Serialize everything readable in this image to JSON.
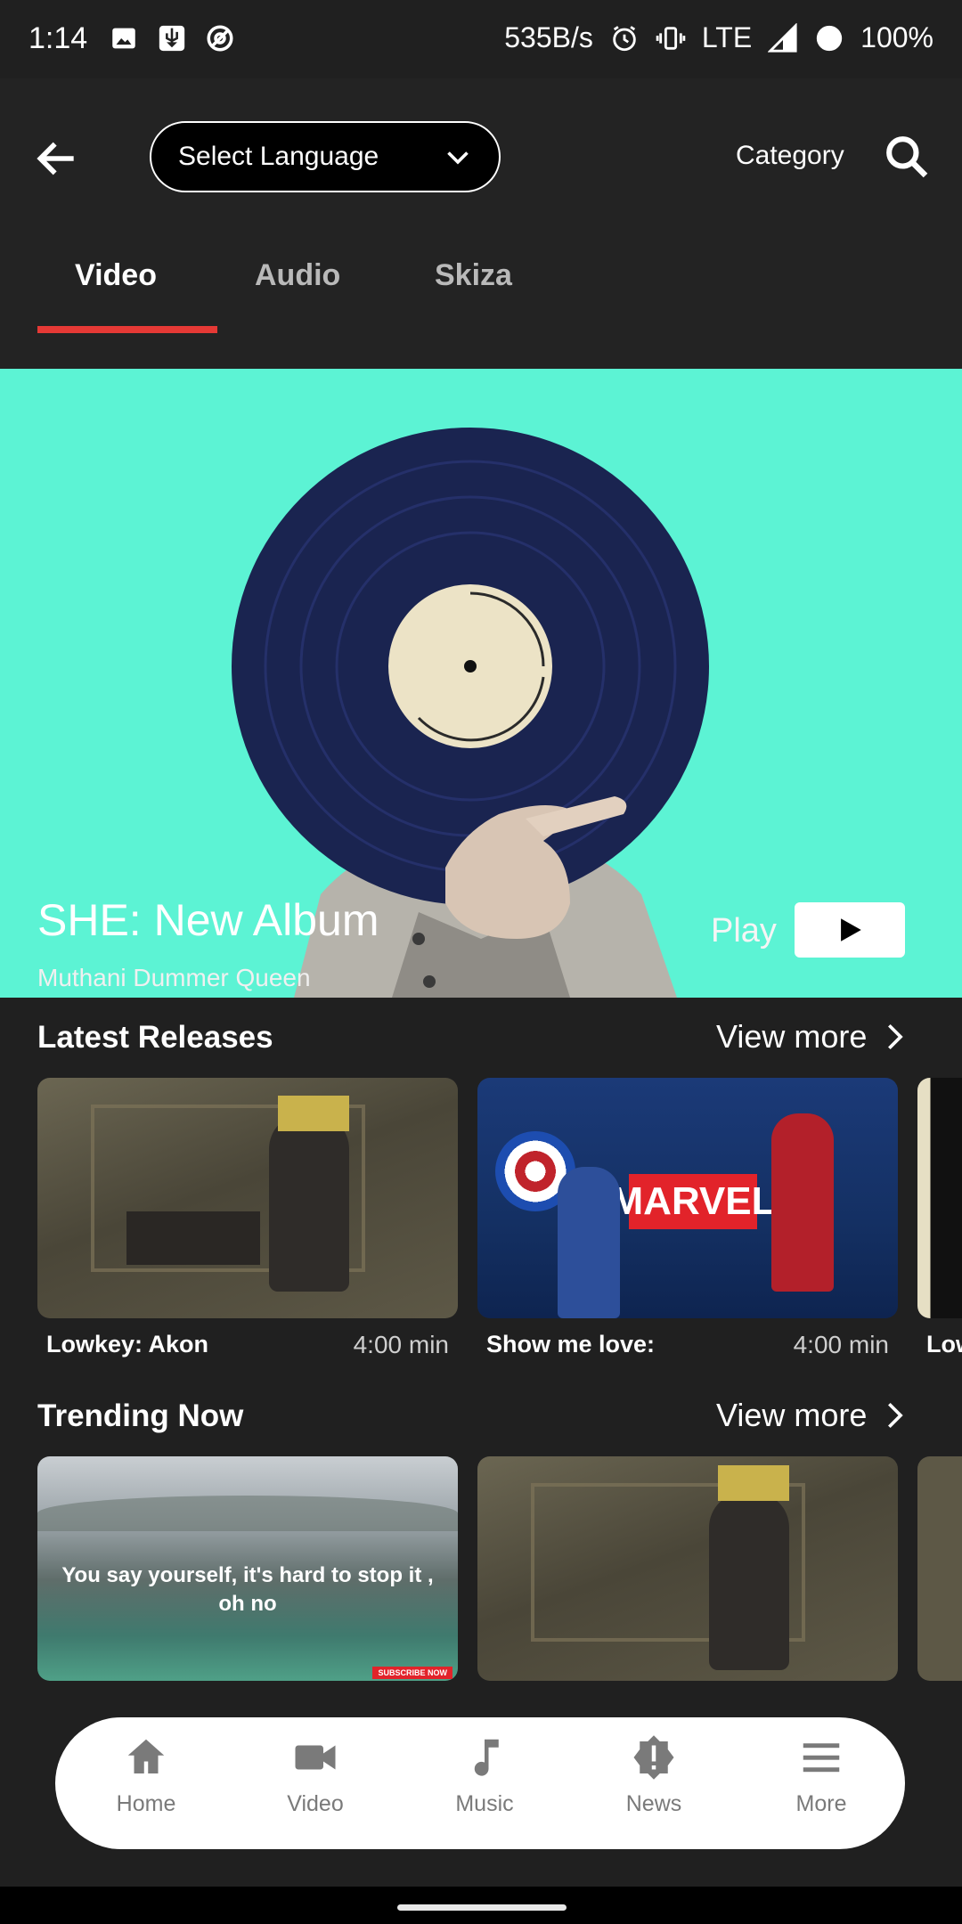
{
  "status_bar": {
    "time": "1:14",
    "net_speed": "535B/s",
    "network": "LTE",
    "battery": "100%"
  },
  "app_bar": {
    "language_placeholder": "Select Language",
    "category_label": "Category"
  },
  "tabs": [
    {
      "label": "Video",
      "active": true
    },
    {
      "label": "Audio",
      "active": false
    },
    {
      "label": "Skiza",
      "active": false
    }
  ],
  "hero": {
    "title": "SHE: New Album",
    "subtitle": "Muthani Dummer Queen",
    "play_label": "Play"
  },
  "latest_releases": {
    "title": "Latest Releases",
    "view_more": "View more",
    "items": [
      {
        "title": "Lowkey: Akon",
        "duration": "4:00 min"
      },
      {
        "title": "Show me love:",
        "duration": "4:00 min"
      },
      {
        "title": "Low",
        "duration": ""
      }
    ],
    "marvel_logo": "MARVEL"
  },
  "trending_now": {
    "title": "Trending Now",
    "view_more": "View more",
    "items": [
      {
        "caption": "You say yourself, it's hard to stop it , oh no",
        "badge": "SUBSCRIBE NOW"
      },
      {
        "caption": ""
      },
      {
        "caption": ""
      }
    ]
  },
  "bottom_nav": [
    {
      "label": "Home",
      "icon": "home-icon"
    },
    {
      "label": "Video",
      "icon": "video-camera-icon"
    },
    {
      "label": "Music",
      "icon": "music-note-icon"
    },
    {
      "label": "News",
      "icon": "alert-badge-icon"
    },
    {
      "label": "More",
      "icon": "menu-icon"
    }
  ],
  "colors": {
    "background": "#202020",
    "hero_bg": "#5cf3d4",
    "tab_indicator": "#e53935",
    "nav_bg": "#ffffff"
  }
}
